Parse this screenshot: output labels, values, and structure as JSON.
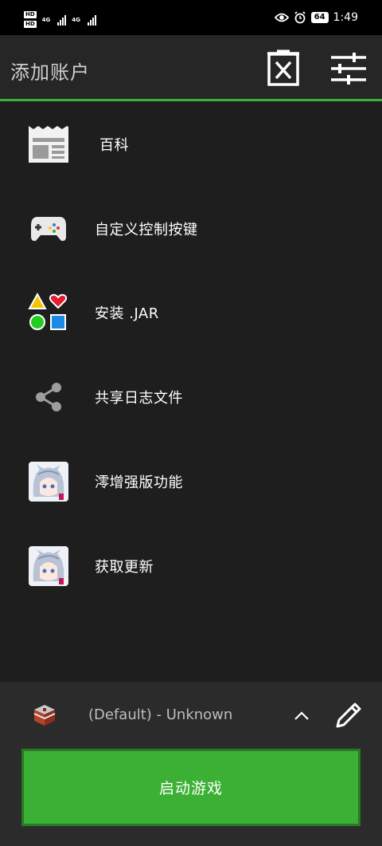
{
  "status_bar": {
    "hd_badges": [
      "HD",
      "HD"
    ],
    "network_labels": [
      "4G",
      "4G"
    ],
    "battery": "64",
    "time": "1:49"
  },
  "app_bar": {
    "title": "添加账户",
    "icons": [
      "delete-account-icon",
      "settings-sliders-icon"
    ],
    "accent_color": "#3eb134"
  },
  "menu": {
    "items": [
      {
        "label": "百科",
        "icon": "wiki-icon"
      },
      {
        "label": "自定义控制按键",
        "icon": "gamepad-icon"
      },
      {
        "label": "安装 .JAR",
        "icon": "shapes-icon"
      },
      {
        "label": "共享日志文件",
        "icon": "share-icon"
      },
      {
        "label": "澪增强版功能",
        "icon": "anime-avatar-icon"
      },
      {
        "label": "获取更新",
        "icon": "anime-avatar-icon"
      }
    ]
  },
  "bottom": {
    "version_label": "(Default) - Unknown",
    "version_icon": "tnt-block-icon",
    "launch_label": "启动游戏",
    "launch_color": "#3cb034"
  }
}
